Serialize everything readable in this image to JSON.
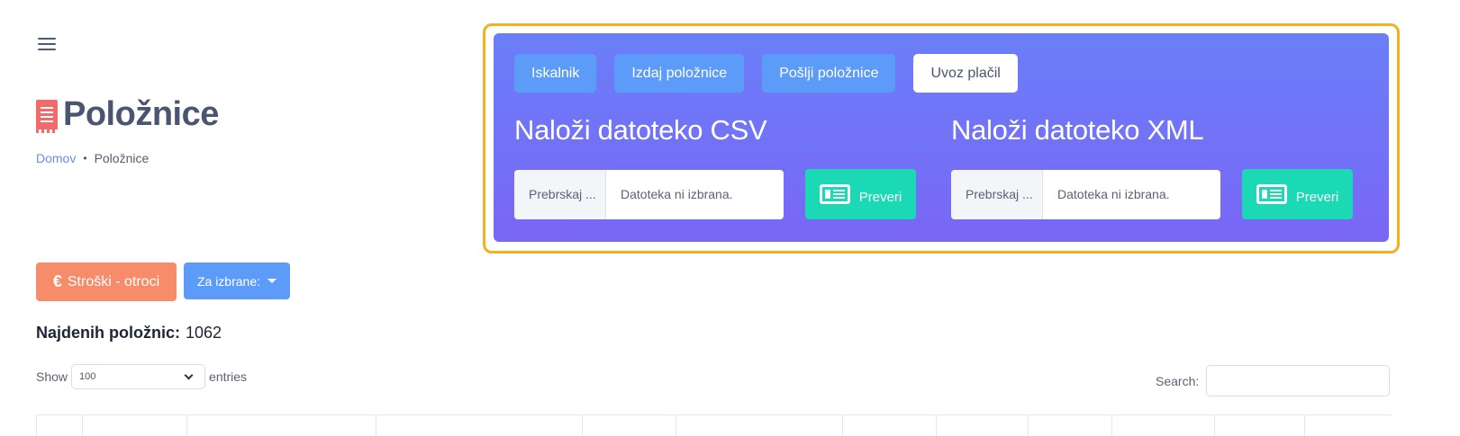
{
  "page": {
    "title": "Položnice",
    "breadcrumb": {
      "home": "Domov",
      "separator": "•",
      "current": "Položnice"
    }
  },
  "panel": {
    "tabs": [
      {
        "label": "Iskalnik",
        "active": false
      },
      {
        "label": "Izdaj položnice",
        "active": false
      },
      {
        "label": "Pošlji položnice",
        "active": false
      },
      {
        "label": "Uvoz plačil",
        "active": true
      }
    ],
    "csv": {
      "heading": "Naloži datoteko CSV",
      "browse_label": "Prebrskaj ...",
      "file_placeholder": "Datoteka ni izbrana.",
      "check_label": "Preveri"
    },
    "xml": {
      "heading": "Naloži datoteko XML",
      "browse_label": "Prebrskaj ...",
      "file_placeholder": "Datoteka ni izbrana.",
      "check_label": "Preveri"
    }
  },
  "actions": {
    "costs_label": "Stroški - otroci",
    "selected_label": "Za izbrane:"
  },
  "results": {
    "found_label": "Najdenih položnic:",
    "found_count": "1062"
  },
  "table_controls": {
    "show_label": "Show",
    "entries_value": "100",
    "entries_label": "entries",
    "search_label": "Search:"
  },
  "colors": {
    "panel_gradient_top": "#6a7ff8",
    "panel_gradient_bottom": "#7a66f6",
    "tab_blue": "#5c9cf8",
    "check_green": "#1ad9b4",
    "costs_orange": "#f78c6b",
    "highlight_frame": "#f5b11d",
    "title_icon": "#f26b6b"
  },
  "icons": [
    "hamburger-icon",
    "receipt-icon",
    "newspaper-icon",
    "euro-icon",
    "caret-down-icon",
    "chevron-down-icon"
  ]
}
